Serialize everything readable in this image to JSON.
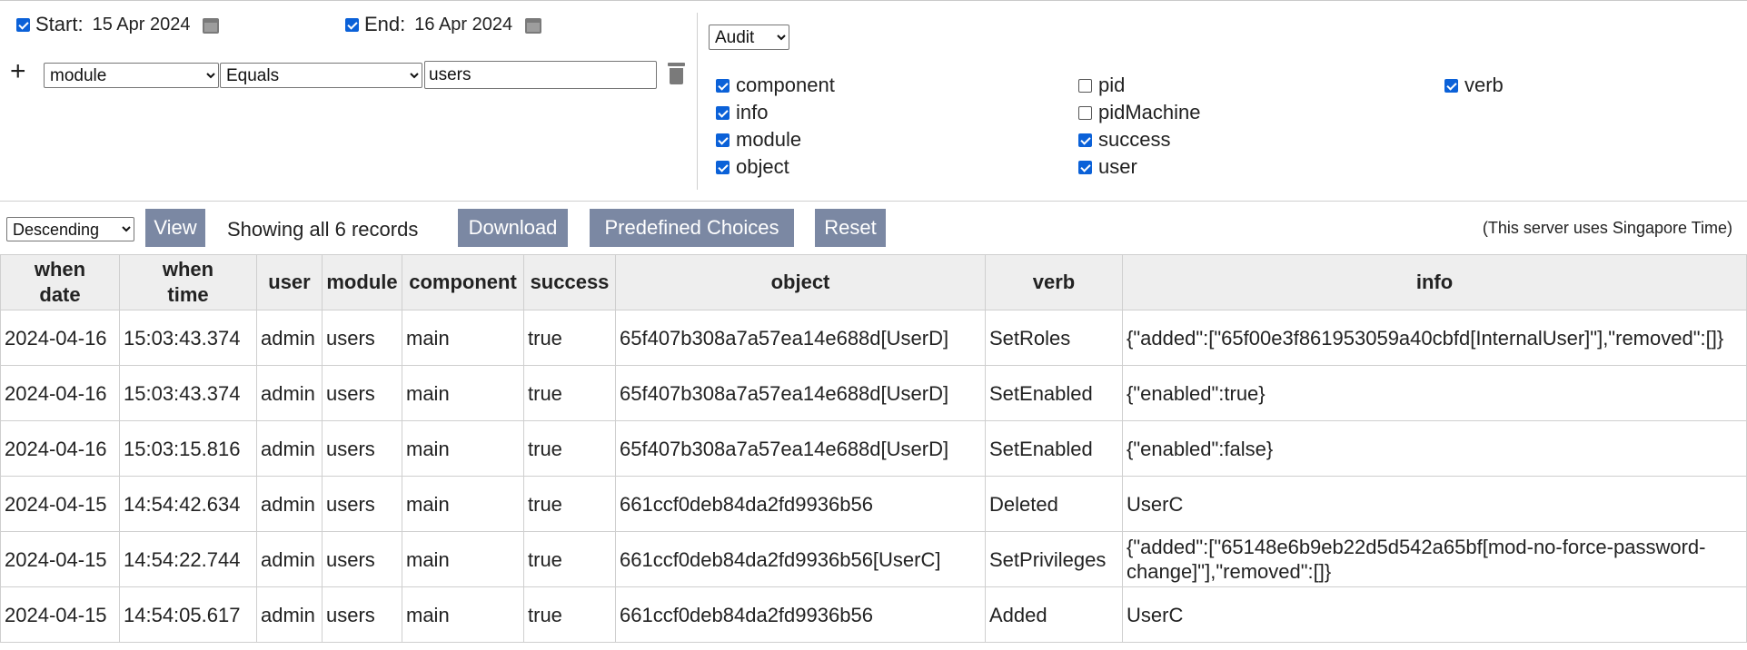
{
  "date_range": {
    "start_label": "Start:",
    "start_value": "15 Apr 2024",
    "start_checked": true,
    "end_label": "End:",
    "end_value": "16 Apr 2024",
    "end_checked": true
  },
  "filter": {
    "add_icon": "plus-icon",
    "field": "module",
    "operator": "Equals",
    "value": "users",
    "delete_icon": "trash-icon"
  },
  "audit": {
    "selected": "Audit",
    "fields": [
      {
        "label": "component",
        "checked": true
      },
      {
        "label": "info",
        "checked": true
      },
      {
        "label": "module",
        "checked": true
      },
      {
        "label": "object",
        "checked": true
      },
      {
        "label": "pid",
        "checked": false
      },
      {
        "label": "pidMachine",
        "checked": false
      },
      {
        "label": "success",
        "checked": true
      },
      {
        "label": "user",
        "checked": true
      },
      {
        "label": "verb",
        "checked": true
      }
    ]
  },
  "toolbar": {
    "order": "Descending",
    "view_label": "View",
    "showing_text": "Showing all 6 records",
    "download_label": "Download",
    "predefined_label": "Predefined Choices",
    "reset_label": "Reset",
    "timezone_note": "(This server uses Singapore Time)",
    "button_color": "#7b88a3"
  },
  "table": {
    "headers": [
      "when\ndate",
      "when\ntime",
      "user",
      "module",
      "component",
      "success",
      "object",
      "verb",
      "info"
    ],
    "rows": [
      [
        "2024-04-16",
        "15:03:43.374",
        "admin",
        "users",
        "main",
        "true",
        "65f407b308a7a57ea14e688d[UserD]",
        "SetRoles",
        "{\"added\":[\"65f00e3f861953059a40cbfd[InternalUser]\"],\"removed\":[]}"
      ],
      [
        "2024-04-16",
        "15:03:43.374",
        "admin",
        "users",
        "main",
        "true",
        "65f407b308a7a57ea14e688d[UserD]",
        "SetEnabled",
        "{\"enabled\":true}"
      ],
      [
        "2024-04-16",
        "15:03:15.816",
        "admin",
        "users",
        "main",
        "true",
        "65f407b308a7a57ea14e688d[UserD]",
        "SetEnabled",
        "{\"enabled\":false}"
      ],
      [
        "2024-04-15",
        "14:54:42.634",
        "admin",
        "users",
        "main",
        "true",
        "661ccf0deb84da2fd9936b56",
        "Deleted",
        "UserC"
      ],
      [
        "2024-04-15",
        "14:54:22.744",
        "admin",
        "users",
        "main",
        "true",
        "661ccf0deb84da2fd9936b56[UserC]",
        "SetPrivileges",
        "{\"added\":[\"65148e6b9eb22d5d542a65bf[mod-no-force-password-change]\"],\"removed\":[]}"
      ],
      [
        "2024-04-15",
        "14:54:05.617",
        "admin",
        "users",
        "main",
        "true",
        "661ccf0deb84da2fd9936b56",
        "Added",
        "UserC"
      ]
    ]
  }
}
